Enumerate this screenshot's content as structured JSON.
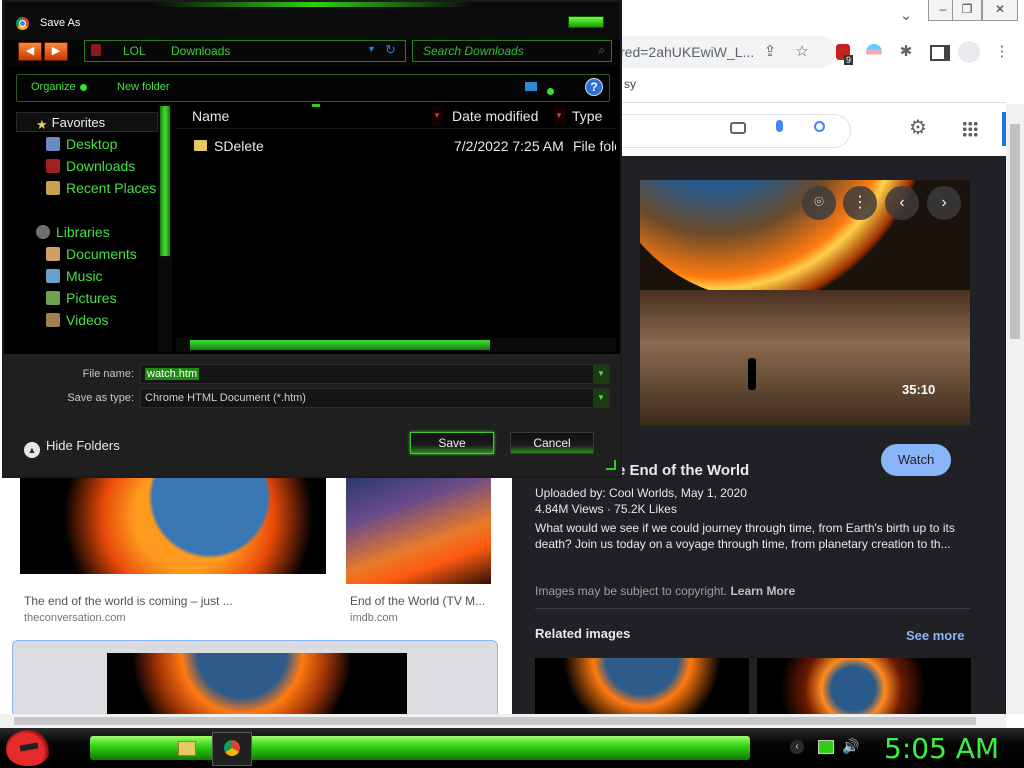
{
  "browser": {
    "url_fragment": "red=2ahUKEwiW_L...",
    "bookmarks_fragment": "sy",
    "ext_badge": "9",
    "results": [
      {
        "title": "The end of the world is coming – just ...",
        "domain": "theconversation.com"
      },
      {
        "title": "End of the World (TV M...",
        "domain": "imdb.com"
      }
    ],
    "preview": {
      "duration": "35:10",
      "watch_label": "Watch",
      "title": "e End of the World",
      "uploaded": "Uploaded by: Cool Worlds, May 1, 2020",
      "stats": "4.84M Views · 75.2K Likes",
      "description": "What would we see if we could journey through time, from Earth's birth up to its death? Join us today on a voyage through time, from planetary creation to th...",
      "copyright": "Images may be subject to copyright.",
      "learn_more": "Learn More",
      "related": "Related images",
      "see_more": "See more"
    }
  },
  "dialog": {
    "title": "Save As",
    "path": [
      "LOL",
      "Downloads"
    ],
    "search_placeholder": "Search Downloads",
    "commands": {
      "organize": "Organize",
      "new_folder": "New folder"
    },
    "nav": {
      "favorites_header": "Favorites",
      "favorites": [
        "Desktop",
        "Downloads",
        "Recent Places"
      ],
      "libraries_header": "Libraries",
      "libraries": [
        "Documents",
        "Music",
        "Pictures",
        "Videos"
      ]
    },
    "columns": {
      "name": "Name",
      "date": "Date modified",
      "type": "Type"
    },
    "files": [
      {
        "name": "SDelete",
        "date": "7/2/2022 7:25 AM",
        "type": "File fold"
      }
    ],
    "file_name_label": "File name:",
    "file_name_value": "watch.htm",
    "save_type_label": "Save as type:",
    "save_type_value": "Chrome HTML Document (*.htm)",
    "hide_folders": "Hide Folders",
    "save_label": "Save",
    "cancel_label": "Cancel"
  },
  "taskbar": {
    "clock": "5:05 AM"
  },
  "colors": {
    "accent_green": "#3ef03e",
    "chrome_blue": "#8ab4f8",
    "dialog_bg": "#000000"
  }
}
